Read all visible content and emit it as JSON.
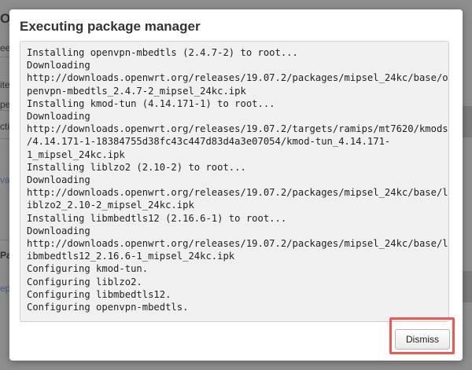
{
  "dialog": {
    "title": "Executing package manager",
    "log_lines": [
      "Installing openvpn-mbedtls (2.4.7-2) to root...",
      "Downloading",
      "http://downloads.openwrt.org/releases/19.07.2/packages/mipsel_24kc/base/o",
      "penvpn-mbedtls_2.4.7-2_mipsel_24kc.ipk",
      "Installing kmod-tun (4.14.171-1) to root...",
      "Downloading",
      "http://downloads.openwrt.org/releases/19.07.2/targets/ramips/mt7620/kmods",
      "/4.14.171-1-18384755d38fc43c447d83d4a3e07054/kmod-tun_4.14.171-",
      "1_mipsel_24kc.ipk",
      "Installing liblzo2 (2.10-2) to root...",
      "Downloading",
      "http://downloads.openwrt.org/releases/19.07.2/packages/mipsel_24kc/base/l",
      "iblzo2_2.10-2_mipsel_24kc.ipk",
      "Installing libmbedtls12 (2.16.6-1) to root...",
      "Downloading",
      "http://downloads.openwrt.org/releases/19.07.2/packages/mipsel_24kc/base/l",
      "ibmbedtls12_2.16.6-1_mipsel_24kc.ipk",
      "Configuring kmod-tun.",
      "Configuring liblzo2.",
      "Configuring libmbedtls12.",
      "Configuring openvpn-mbedtls."
    ],
    "dismiss_label": "Dismiss"
  },
  "background": {
    "fragments": [
      "O",
      "ee",
      "ite",
      "pe",
      "cti",
      "va",
      "Pa",
      "ep"
    ]
  },
  "colors": {
    "overlay": "#8a8a8a",
    "log_background": "#f0f0f0",
    "highlight": "#f0584f"
  }
}
